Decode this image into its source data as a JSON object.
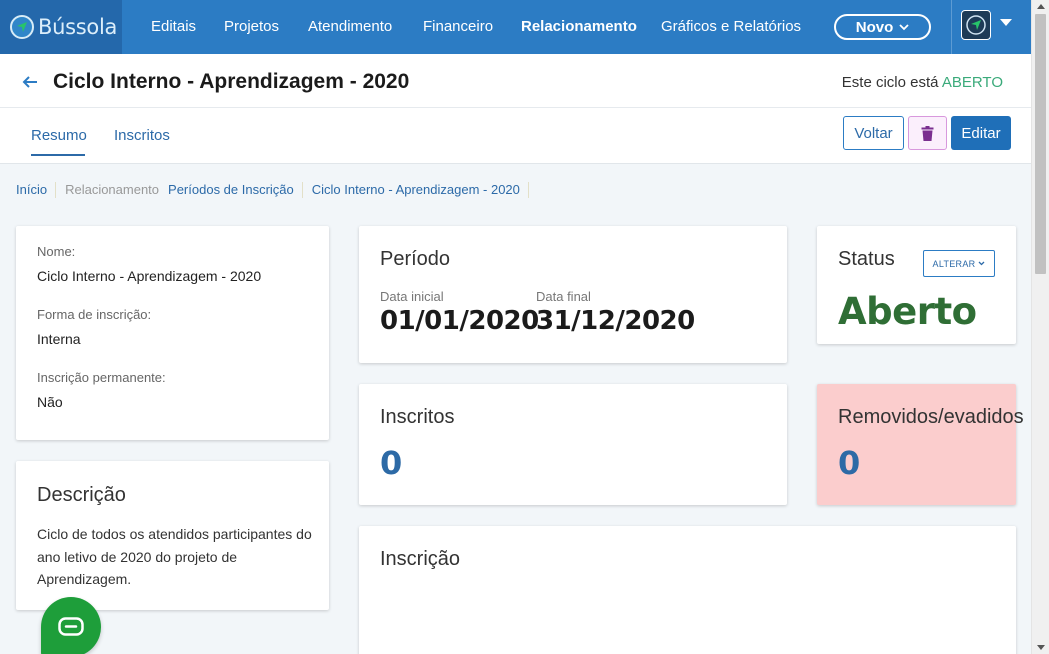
{
  "app": {
    "brand_name": "Bússola",
    "brand_color": "#2c7cc4"
  },
  "nav": {
    "items": [
      {
        "label": "Editais"
      },
      {
        "label": "Projetos"
      },
      {
        "label": "Atendimento"
      },
      {
        "label": "Financeiro"
      },
      {
        "label": "Relacionamento",
        "active": true
      },
      {
        "label": "Gráficos e Relatórios"
      }
    ],
    "novo_label": "Novo"
  },
  "page": {
    "title": "Ciclo Interno - Aprendizagem - 2020",
    "state_prefix": "Este ciclo está",
    "state_value": "ABERTO",
    "tabs": [
      {
        "label": "Resumo",
        "active": true
      },
      {
        "label": "Inscritos"
      }
    ],
    "buttons": {
      "voltar": "Voltar",
      "editar": "Editar"
    }
  },
  "breadcrumb": [
    {
      "label": "Início"
    },
    {
      "label": "Relacionamento"
    },
    {
      "label": "Períodos de Inscrição"
    },
    {
      "label": "Ciclo Interno - Aprendizagem - 2020"
    }
  ],
  "info_card": {
    "nome_label": "Nome:",
    "nome_value": "Ciclo Interno - Aprendizagem - 2020",
    "forma_label": "Forma de inscrição:",
    "forma_value": "Interna",
    "permanente_label": "Inscrição permanente:",
    "permanente_value": "Não"
  },
  "descricao": {
    "title": "Descrição",
    "text": "Ciclo de todos os atendidos participantes do ano letivo de 2020 do projeto de Aprendizagem."
  },
  "periodo": {
    "title": "Período",
    "inicial_label": "Data inicial",
    "inicial_value": "01/01/2020",
    "final_label": "Data final",
    "final_value": "31/12/2020"
  },
  "status": {
    "title": "Status",
    "alterar_label": "ALTERAR",
    "value": "Aberto",
    "value_color": "#2f6e35"
  },
  "inscritos": {
    "title": "Inscritos",
    "value": "0"
  },
  "removidos": {
    "title": "Removidos/evadidos",
    "value": "0",
    "bg_color": "#fbcdcd"
  },
  "inscricao": {
    "title": "Inscrição"
  }
}
